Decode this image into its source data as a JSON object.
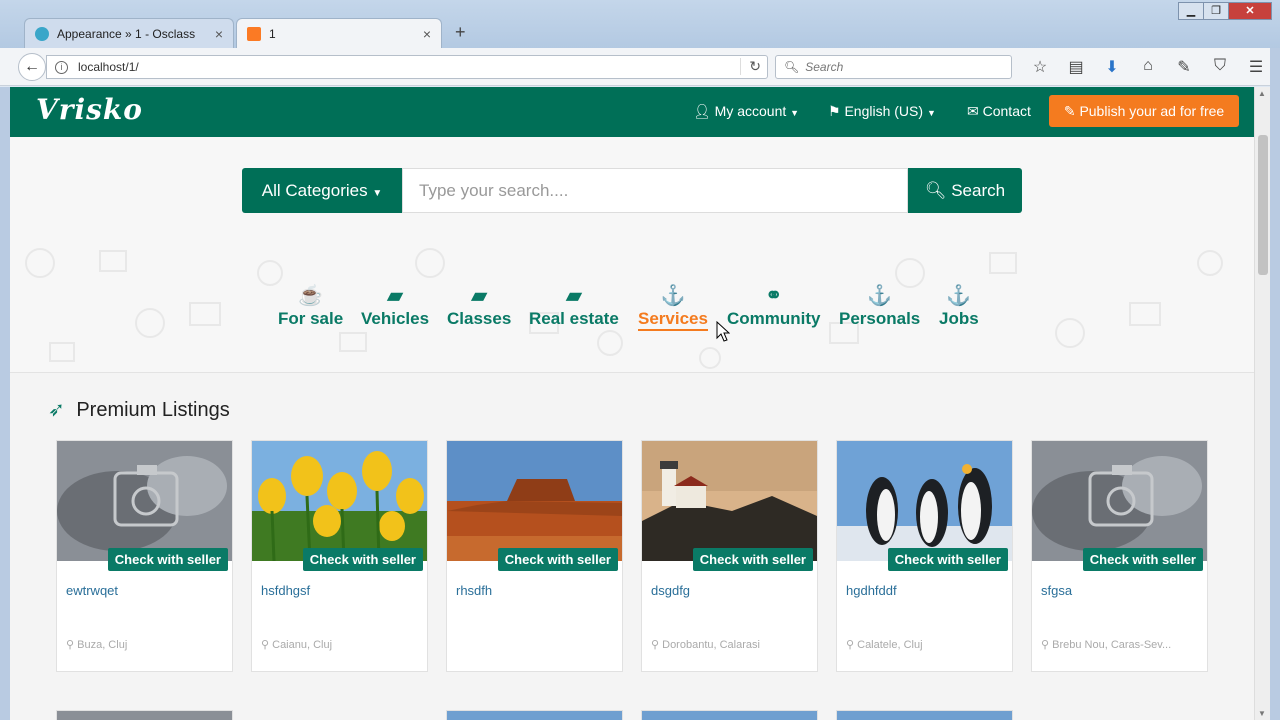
{
  "browser": {
    "tabs": [
      {
        "title": "Appearance » 1 - Osclass",
        "close": "×"
      },
      {
        "title": "1",
        "close": "×"
      }
    ],
    "new_tab": "+",
    "window_buttons": {
      "minimize": "▁",
      "maximize": "❐",
      "close": "✕"
    },
    "back": "←",
    "url": "localhost/1/",
    "reload": "↻",
    "search_placeholder": "Search",
    "toolbar_icons": [
      "star-icon",
      "reader-icon",
      "download-icon",
      "home-icon",
      "wrench-icon",
      "pocket-icon",
      "menu-icon"
    ]
  },
  "site": {
    "logo": "Vrisko",
    "nav": {
      "my_account": "My account",
      "language": "English (US)",
      "contact": "Contact",
      "publish": "Publish your ad for free"
    },
    "search": {
      "category_label": "All Categories",
      "placeholder": "Type your search....",
      "button": "Search"
    },
    "categories": [
      {
        "label": "For sale",
        "icon": "coffee-icon",
        "active": false
      },
      {
        "label": "Vehicles",
        "icon": "book-icon",
        "active": false
      },
      {
        "label": "Classes",
        "icon": "book-icon",
        "active": false
      },
      {
        "label": "Real estate",
        "icon": "book-icon",
        "active": false
      },
      {
        "label": "Services",
        "icon": "anchor-icon",
        "active": true
      },
      {
        "label": "Community",
        "icon": "handshake-icon",
        "active": false
      },
      {
        "label": "Personals",
        "icon": "anchor-icon",
        "active": false
      },
      {
        "label": "Jobs",
        "icon": "anchor-icon",
        "active": false
      }
    ],
    "premium_title": "Premium Listings",
    "listings": [
      {
        "title": "ewtrwqet",
        "location": "Buza, Cluj",
        "badge": "Check with seller",
        "image": "placeholder-camera"
      },
      {
        "title": "hsfdhgsf",
        "location": "Caianu, Cluj",
        "badge": "Check with seller",
        "image": "tulips"
      },
      {
        "title": "rhsdfh",
        "location": "",
        "badge": "Check with seller",
        "image": "desert"
      },
      {
        "title": "dsgdfg",
        "location": "Dorobantu, Calarasi",
        "badge": "Check with seller",
        "image": "lighthouse"
      },
      {
        "title": "hgdhfddf",
        "location": "Calatele, Cluj",
        "badge": "Check with seller",
        "image": "penguins"
      },
      {
        "title": "sfgsa",
        "location": "Brebu Nou, Caras-Sev...",
        "badge": "Check with seller",
        "image": "placeholder-camera"
      }
    ],
    "colors": {
      "primary": "#006f57",
      "accent": "#f47b1f",
      "link": "#2a6f99"
    }
  }
}
